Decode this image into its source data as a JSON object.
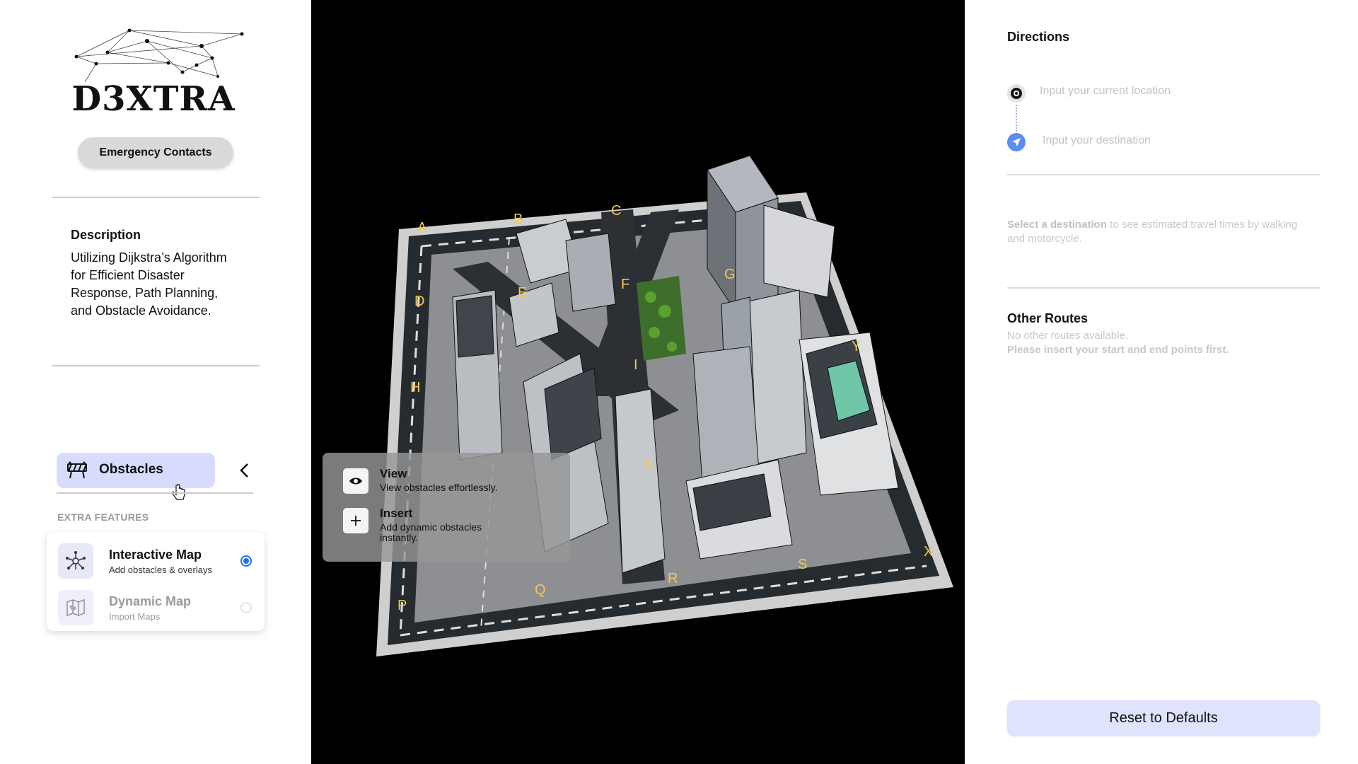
{
  "brand": {
    "logo_text": "D3XTRA"
  },
  "sidebar": {
    "emergency_button": "Emergency Contacts",
    "description_title": "Description",
    "description_body": "Utilizing Dijkstra’s Algorithm for Efficient Disaster Response, Path Planning, and Obstacle Avoidance.",
    "obstacles_label": "Obstacles",
    "extra_features_label": "EXTRA FEATURES",
    "features": [
      {
        "title": "Interactive Map",
        "subtitle": "Add obstacles & overlays",
        "selected": true,
        "icon": "network-icon"
      },
      {
        "title": "Dynamic Map",
        "subtitle": "Import Maps",
        "selected": false,
        "icon": "map-icon"
      }
    ]
  },
  "map": {
    "node_labels": [
      "A",
      "B",
      "C",
      "D",
      "E",
      "F",
      "G",
      "H",
      "I",
      "N",
      "P",
      "Q",
      "R",
      "S",
      "X",
      "Y"
    ],
    "popup": {
      "items": [
        {
          "title": "View",
          "subtitle": "View obstacles effortlessly.",
          "icon": "eye-icon"
        },
        {
          "title": "Insert",
          "subtitle": "Add dynamic obstacles instantly.",
          "icon": "plus-icon"
        }
      ]
    }
  },
  "directions": {
    "title": "Directions",
    "origin_placeholder": "Input your current location",
    "destination_placeholder": "Input your destination",
    "hint_bold": "Select a destination",
    "hint_rest": " to see estimated travel times by walking and motorcycle.",
    "other_routes_title": "Other Routes",
    "other_routes_empty": "No other routes available.",
    "other_routes_instruction": "Please insert your start and end points first.",
    "reset_button": "Reset to Defaults"
  },
  "colors": {
    "accent": "#1a73e8",
    "obstacles_bg": "#d7dcff",
    "reset_bg": "#dfe3fb",
    "label_yellow": "#f2c94c"
  }
}
